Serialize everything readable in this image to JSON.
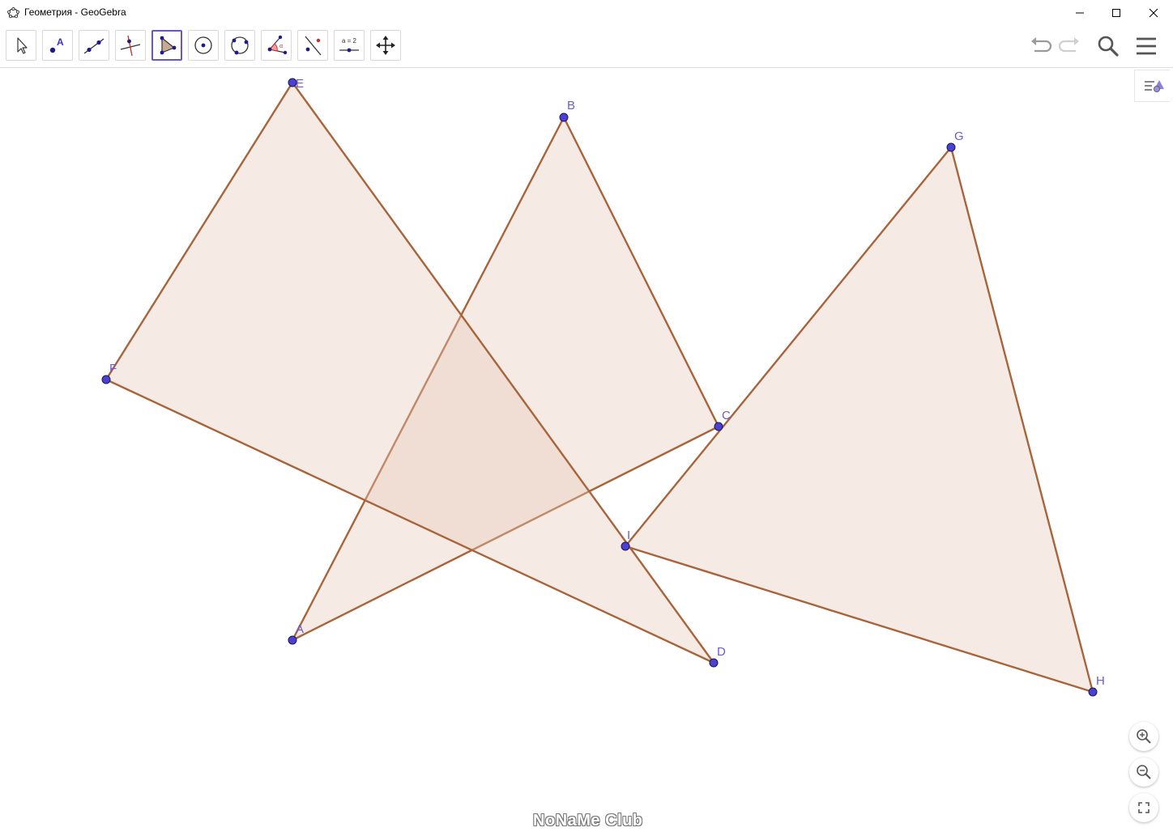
{
  "window": {
    "title": "Геометрия - GeoGebra",
    "icon": "geogebra-pentagon-icon",
    "controls": [
      "minimize-icon",
      "maximize-icon",
      "close-icon"
    ]
  },
  "toolbar": {
    "tools": [
      {
        "name": "move-tool",
        "icon": "arrow-cursor-icon",
        "selected": false
      },
      {
        "name": "point-tool",
        "icon": "point-a-icon",
        "selected": false
      },
      {
        "name": "line-tool",
        "icon": "line-through-two-points-icon",
        "selected": false
      },
      {
        "name": "perpendicular-line-tool",
        "icon": "perpendicular-line-icon",
        "selected": false
      },
      {
        "name": "polygon-tool",
        "icon": "polygon-icon",
        "selected": true
      },
      {
        "name": "circle-center-point-tool",
        "icon": "circle-center-icon",
        "selected": false
      },
      {
        "name": "circle-three-points-tool",
        "icon": "circle-three-points-icon",
        "selected": false
      },
      {
        "name": "angle-tool",
        "icon": "angle-icon",
        "selected": false
      },
      {
        "name": "reflect-about-line-tool",
        "icon": "reflect-icon",
        "selected": false
      },
      {
        "name": "slider-tool",
        "icon": "slider-icon",
        "label": "a = 2",
        "selected": false
      },
      {
        "name": "move-graphics-view-tool",
        "icon": "move-view-icon",
        "selected": false
      }
    ],
    "right": [
      "undo-icon",
      "redo-icon",
      "search-icon",
      "menu-icon"
    ]
  },
  "colors": {
    "accent": "#6557d2",
    "point_fill": "#4b3fd6",
    "point_label": "#6c5ccc",
    "polygon_stroke": "#a8643a",
    "polygon_fill": "#e8c8b8"
  },
  "geometry": {
    "points": [
      {
        "name": "A",
        "label": "A"
      },
      {
        "name": "B",
        "label": "B"
      },
      {
        "name": "C",
        "label": "C"
      },
      {
        "name": "D",
        "label": "D"
      },
      {
        "name": "E",
        "label": "E"
      },
      {
        "name": "F",
        "label": "F"
      },
      {
        "name": "G",
        "label": "G"
      },
      {
        "name": "H",
        "label": "H"
      },
      {
        "name": "I",
        "label": "I"
      }
    ],
    "polygons": [
      {
        "name": "ABC",
        "vertices": [
          "A",
          "B",
          "C"
        ]
      },
      {
        "name": "EFD",
        "vertices": [
          "E",
          "F",
          "D"
        ]
      },
      {
        "name": "GHI",
        "vertices": [
          "G",
          "H",
          "I"
        ]
      }
    ]
  },
  "zoom_controls": [
    "zoom-in-icon",
    "zoom-out-icon",
    "fullscreen-icon"
  ],
  "watermark": "NoNaMe Club"
}
